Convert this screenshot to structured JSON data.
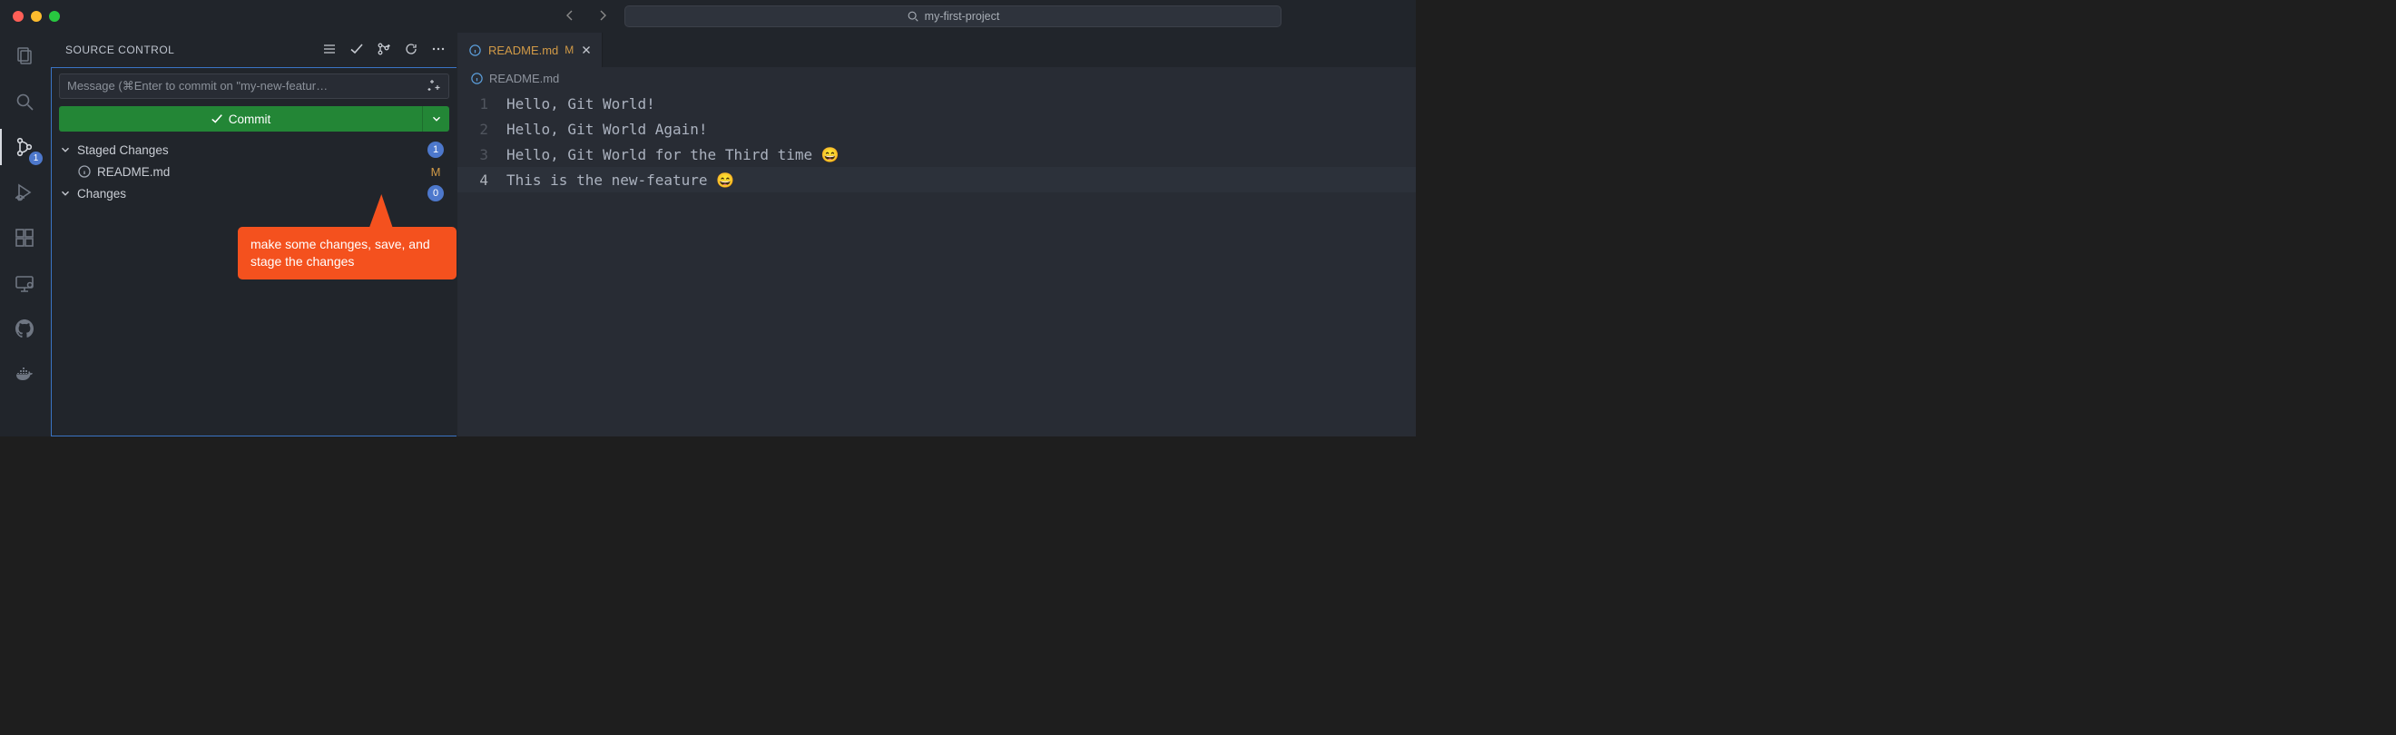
{
  "titlebar": {
    "project_name": "my-first-project"
  },
  "activitybar": {
    "scm_badge": "1"
  },
  "sidebar": {
    "title": "SOURCE CONTROL",
    "commit_placeholder": "Message (⌘Enter to commit on \"my-new-featur…",
    "commit_button": "Commit",
    "staged": {
      "label": "Staged Changes",
      "count": "1",
      "file": "README.md",
      "file_status": "M"
    },
    "changes": {
      "label": "Changes",
      "count": "0"
    }
  },
  "callout": {
    "text": "make some changes, save, and stage the changes"
  },
  "editor": {
    "tab": {
      "name": "README.md",
      "status": "M"
    },
    "breadcrumb": "README.md",
    "lines": [
      {
        "num": "1",
        "text": "Hello, Git World!"
      },
      {
        "num": "2",
        "text": "Hello, Git World Again!"
      },
      {
        "num": "3",
        "text": "Hello, Git World for the Third time 😄"
      },
      {
        "num": "4",
        "text": "This is the new-feature 😄"
      }
    ],
    "current_line": 4
  }
}
